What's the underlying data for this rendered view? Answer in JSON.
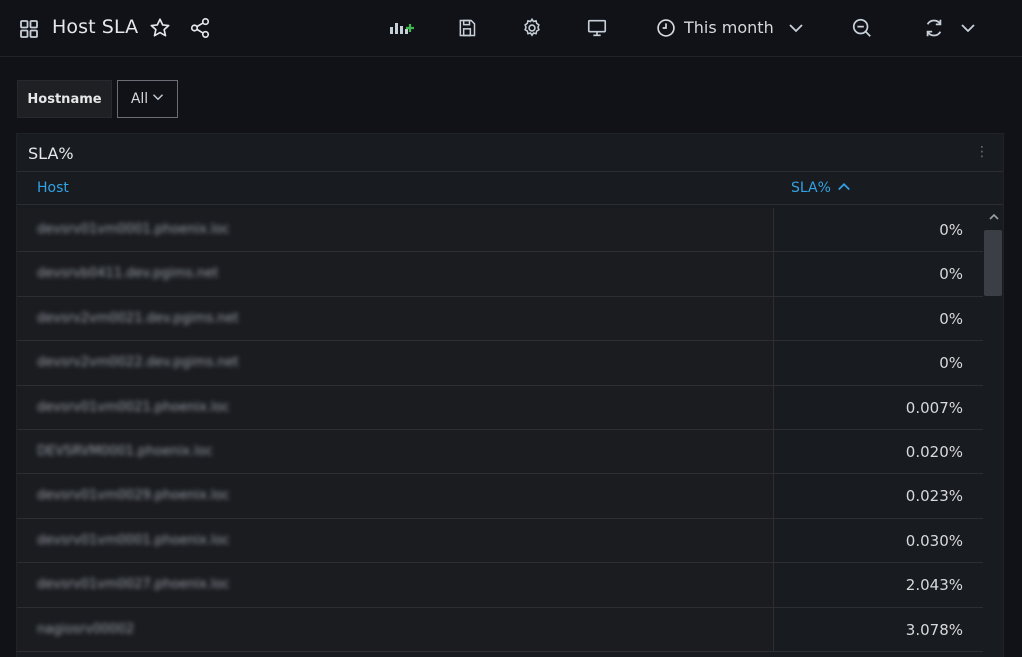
{
  "header": {
    "title": "Host SLA",
    "time_range": "This month"
  },
  "variable": {
    "label": "Hostname",
    "value": "All"
  },
  "panel": {
    "title": "SLA%",
    "columns": {
      "host": "Host",
      "sla": "SLA%"
    },
    "rows": [
      {
        "host": "devsrv01vm0001.phoenix.loc",
        "sla": "0%"
      },
      {
        "host": "devsrvb0411.dev.pgims.net",
        "sla": "0%"
      },
      {
        "host": "devsrv2vm0021.dev.pgims.net",
        "sla": "0%"
      },
      {
        "host": "devsrv2vm0022.dev.pgims.net",
        "sla": "0%"
      },
      {
        "host": "devsrv01vm0021.phoenix.loc",
        "sla": "0.007%"
      },
      {
        "host": "DEVSRVM0001.phoenix.loc",
        "sla": "0.020%"
      },
      {
        "host": "devsrv01vm0029.phoenix.loc",
        "sla": "0.023%"
      },
      {
        "host": "devsrv01vm0001.phoenix.loc",
        "sla": "0.030%"
      },
      {
        "host": "devsrv01vm0027.phoenix.loc",
        "sla": "2.043%"
      },
      {
        "host": "nagiosrv00002",
        "sla": "3.078%"
      }
    ]
  },
  "icons": {
    "dashboard": "grid-icon",
    "star": "star-icon",
    "share": "share-icon",
    "add_panel": "add-panel-icon",
    "save": "save-icon",
    "settings": "gear-icon",
    "tv": "monitor-icon",
    "clock": "clock-icon",
    "zoom_out": "zoom-out-icon",
    "refresh": "refresh-icon"
  },
  "colors": {
    "accent": "#33a2e5",
    "background": "#111217",
    "panel": "#181b1f"
  }
}
